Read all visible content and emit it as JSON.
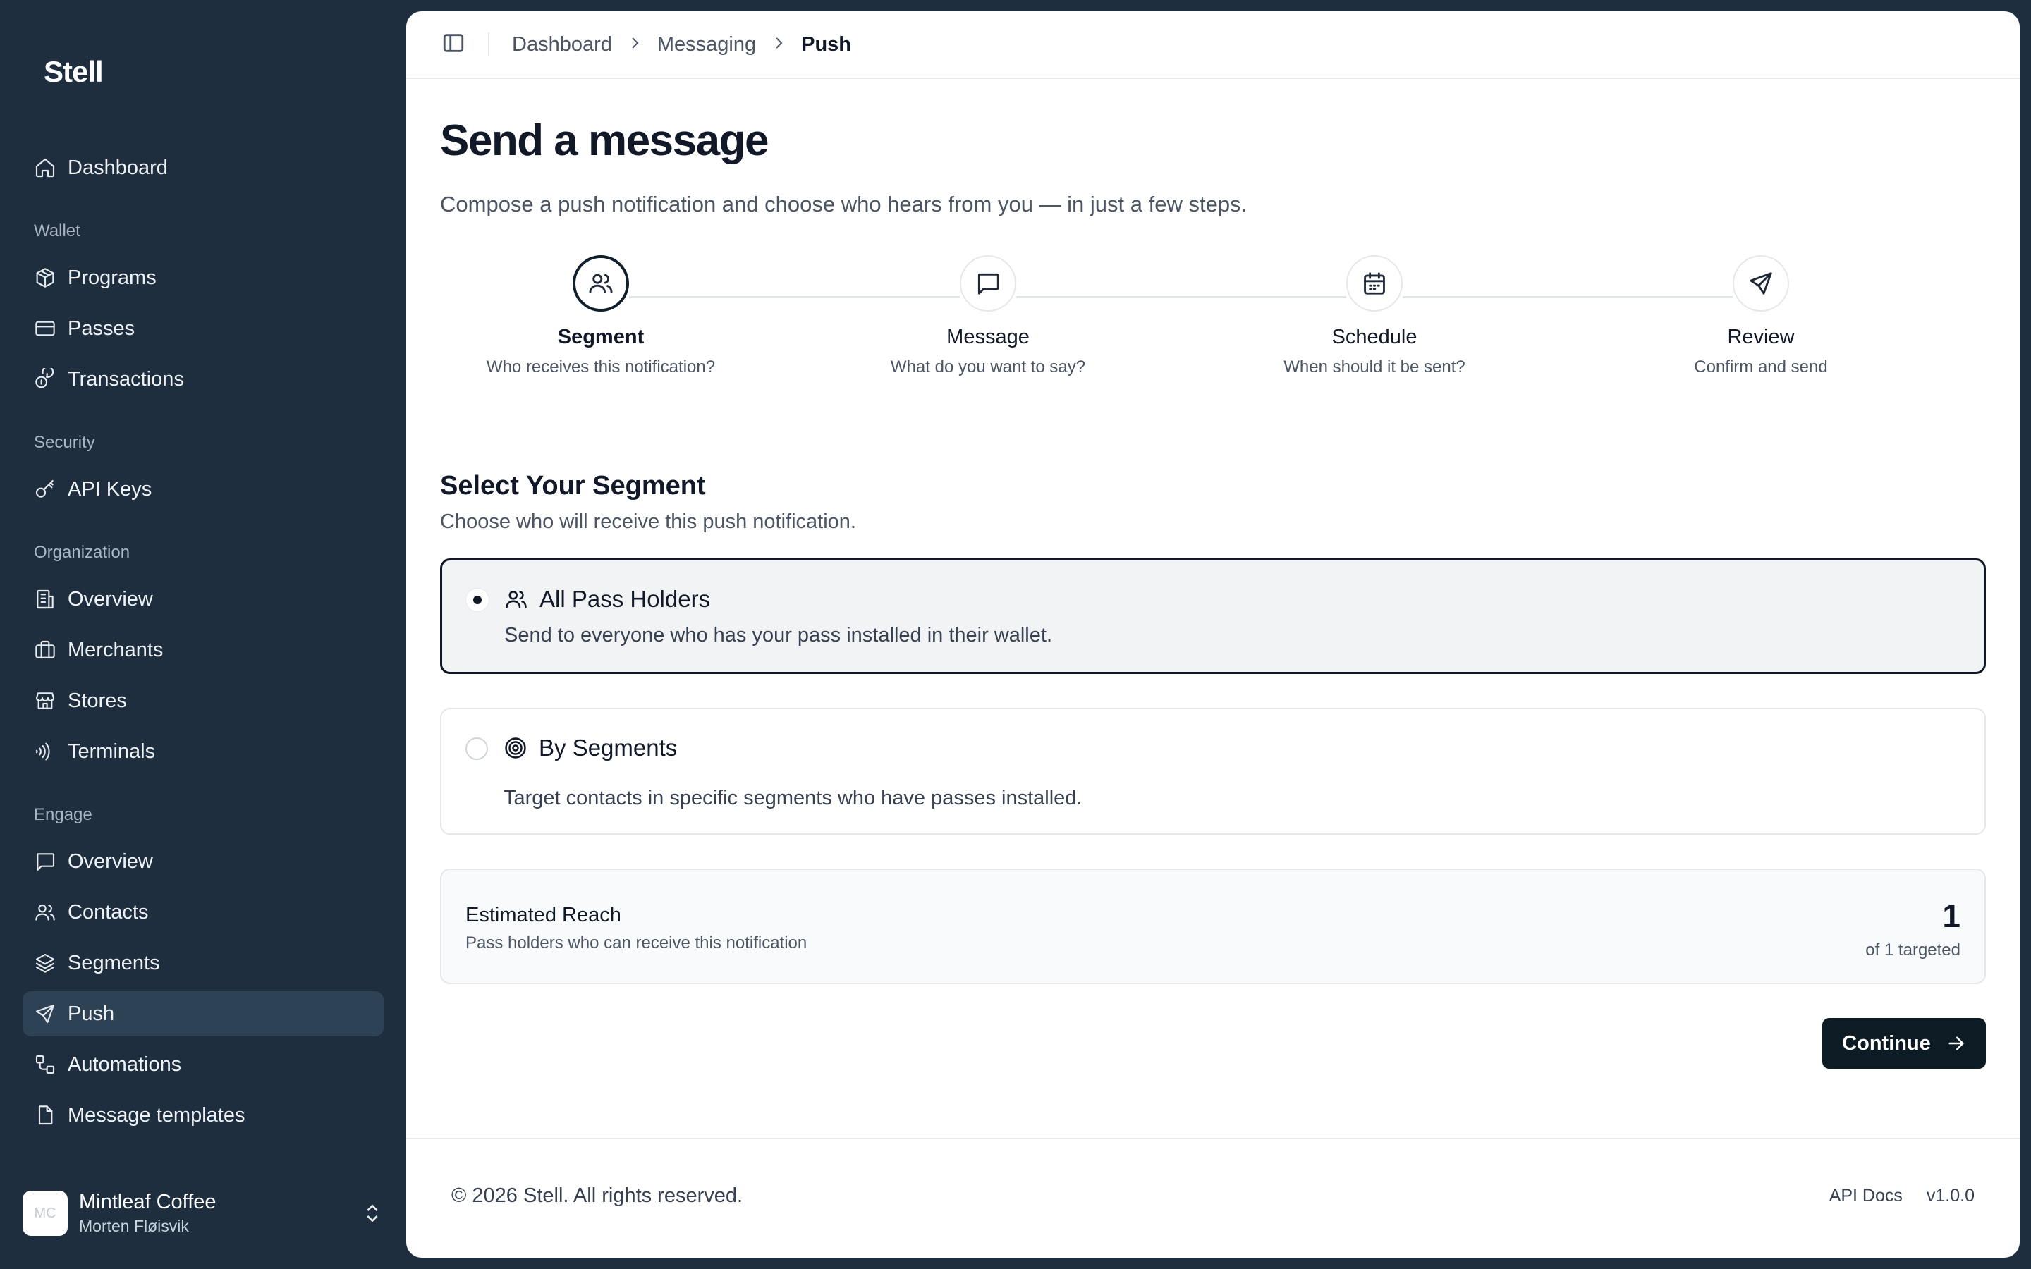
{
  "brand": "Stell",
  "sidebar": {
    "top_items": [
      {
        "label": "Dashboard",
        "icon": "home-icon"
      }
    ],
    "groups": [
      {
        "label": "Wallet",
        "items": [
          {
            "label": "Programs",
            "icon": "box-icon"
          },
          {
            "label": "Passes",
            "icon": "card-icon"
          },
          {
            "label": "Transactions",
            "icon": "coins-icon"
          }
        ]
      },
      {
        "label": "Security",
        "items": [
          {
            "label": "API Keys",
            "icon": "key-icon"
          }
        ]
      },
      {
        "label": "Organization",
        "items": [
          {
            "label": "Overview",
            "icon": "building-icon"
          },
          {
            "label": "Merchants",
            "icon": "briefcase-icon"
          },
          {
            "label": "Stores",
            "icon": "store-icon"
          },
          {
            "label": "Terminals",
            "icon": "nfc-icon"
          }
        ]
      },
      {
        "label": "Engage",
        "items": [
          {
            "label": "Overview",
            "icon": "message-icon"
          },
          {
            "label": "Contacts",
            "icon": "users-icon"
          },
          {
            "label": "Segments",
            "icon": "layers-icon"
          },
          {
            "label": "Push",
            "icon": "send-icon",
            "active": true
          },
          {
            "label": "Automations",
            "icon": "workflow-icon"
          },
          {
            "label": "Message templates",
            "icon": "file-icon"
          }
        ]
      }
    ],
    "user": {
      "org": "Mintleaf Coffee",
      "name": "Morten Fløisvik",
      "initials": "MC"
    }
  },
  "breadcrumb": [
    "Dashboard",
    "Messaging",
    "Push"
  ],
  "page": {
    "title": "Send a message",
    "subtitle": "Compose a push notification and choose who hears from you — in just a few steps."
  },
  "steps": [
    {
      "title": "Segment",
      "desc": "Who receives this notification?",
      "icon": "users-icon",
      "active": true
    },
    {
      "title": "Message",
      "desc": "What do you want to say?",
      "icon": "message-icon",
      "active": false
    },
    {
      "title": "Schedule",
      "desc": "When should it be sent?",
      "icon": "calendar-icon",
      "active": false
    },
    {
      "title": "Review",
      "desc": "Confirm and send",
      "icon": "send-icon",
      "active": false
    }
  ],
  "segment_section": {
    "title": "Select Your Segment",
    "subtitle": "Choose who will receive this push notification."
  },
  "options": [
    {
      "title": "All Pass Holders",
      "desc": "Send to everyone who has your pass installed in their wallet.",
      "icon": "users-icon",
      "selected": true
    },
    {
      "title": "By Segments",
      "desc": "Target contacts in specific segments who have passes installed.",
      "icon": "target-icon",
      "selected": false
    }
  ],
  "reach": {
    "title": "Estimated Reach",
    "subtitle": "Pass holders who can receive this notification",
    "count": "1",
    "of_label": "of 1 targeted"
  },
  "continue_label": "Continue",
  "footer": {
    "copyright": "© 2026 Stell. All rights reserved.",
    "api_docs": "API Docs",
    "version": "v1.0.0"
  }
}
